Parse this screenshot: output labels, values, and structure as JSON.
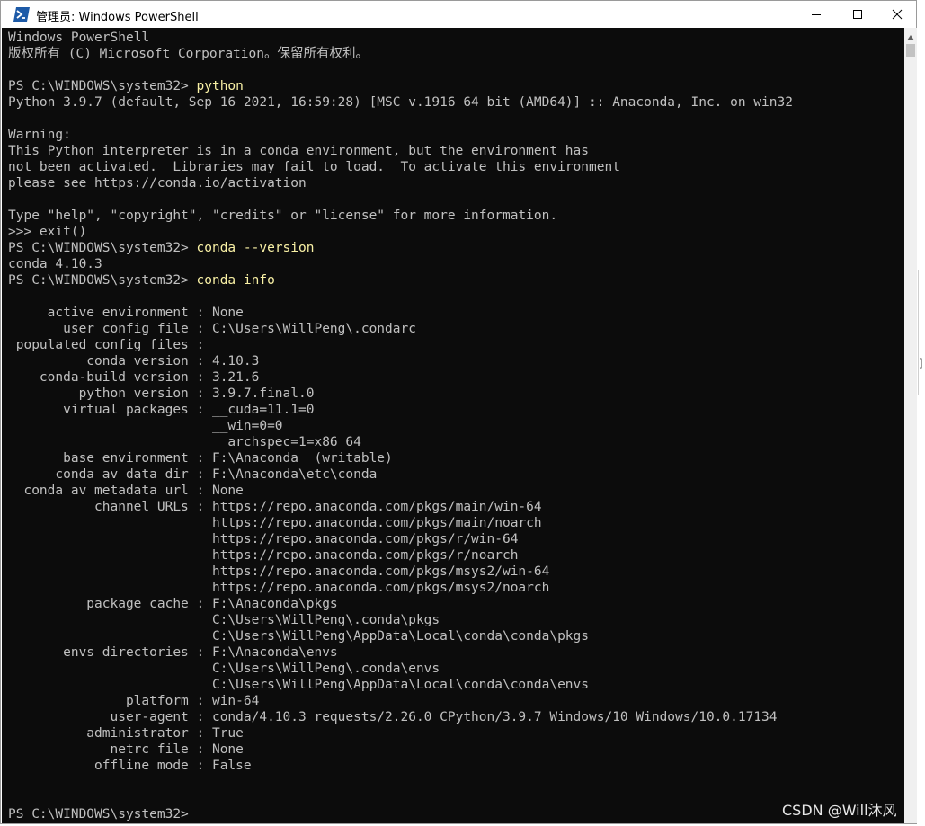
{
  "window": {
    "title": "管理员: Windows PowerShell",
    "icon": "powershell-icon",
    "controls": [
      "minimize-icon",
      "maximize-icon",
      "close-icon"
    ]
  },
  "colors": {
    "console_bg": "#0c0c0c",
    "console_text": "#c0c0c0",
    "command_text": "#f9f1a5",
    "powershell_blue": "#1d5aa7"
  },
  "console": {
    "lines": [
      {
        "text": "Windows PowerShell"
      },
      {
        "text": "版权所有 (C) Microsoft Corporation。保留所有权利。"
      },
      {
        "text": ""
      },
      {
        "prompt": "PS C:\\WINDOWS\\system32> ",
        "command": "python"
      },
      {
        "text": "Python 3.9.7 (default, Sep 16 2021, 16:59:28) [MSC v.1916 64 bit (AMD64)] :: Anaconda, Inc. on win32"
      },
      {
        "text": ""
      },
      {
        "text": "Warning:"
      },
      {
        "text": "This Python interpreter is in a conda environment, but the environment has"
      },
      {
        "text": "not been activated.  Libraries may fail to load.  To activate this environment"
      },
      {
        "text": "please see https://conda.io/activation"
      },
      {
        "text": ""
      },
      {
        "text": "Type \"help\", \"copyright\", \"credits\" or \"license\" for more information."
      },
      {
        "text": ">>> exit()"
      },
      {
        "prompt": "PS C:\\WINDOWS\\system32> ",
        "command": "conda --version"
      },
      {
        "text": "conda 4.10.3"
      },
      {
        "prompt": "PS C:\\WINDOWS\\system32> ",
        "command": "conda info"
      },
      {
        "text": ""
      },
      {
        "text": "     active environment : None"
      },
      {
        "text": "       user config file : C:\\Users\\WillPeng\\.condarc"
      },
      {
        "text": " populated config files : "
      },
      {
        "text": "          conda version : 4.10.3"
      },
      {
        "text": "    conda-build version : 3.21.6"
      },
      {
        "text": "         python version : 3.9.7.final.0"
      },
      {
        "text": "       virtual packages : __cuda=11.1=0"
      },
      {
        "text": "                          __win=0=0"
      },
      {
        "text": "                          __archspec=1=x86_64"
      },
      {
        "text": "       base environment : F:\\Anaconda  (writable)"
      },
      {
        "text": "      conda av data dir : F:\\Anaconda\\etc\\conda"
      },
      {
        "text": "  conda av metadata url : None"
      },
      {
        "text": "           channel URLs : https://repo.anaconda.com/pkgs/main/win-64"
      },
      {
        "text": "                          https://repo.anaconda.com/pkgs/main/noarch"
      },
      {
        "text": "                          https://repo.anaconda.com/pkgs/r/win-64"
      },
      {
        "text": "                          https://repo.anaconda.com/pkgs/r/noarch"
      },
      {
        "text": "                          https://repo.anaconda.com/pkgs/msys2/win-64"
      },
      {
        "text": "                          https://repo.anaconda.com/pkgs/msys2/noarch"
      },
      {
        "text": "          package cache : F:\\Anaconda\\pkgs"
      },
      {
        "text": "                          C:\\Users\\WillPeng\\.conda\\pkgs"
      },
      {
        "text": "                          C:\\Users\\WillPeng\\AppData\\Local\\conda\\conda\\pkgs"
      },
      {
        "text": "       envs directories : F:\\Anaconda\\envs"
      },
      {
        "text": "                          C:\\Users\\WillPeng\\.conda\\envs"
      },
      {
        "text": "                          C:\\Users\\WillPeng\\AppData\\Local\\conda\\conda\\envs"
      },
      {
        "text": "               platform : win-64"
      },
      {
        "text": "             user-agent : conda/4.10.3 requests/2.26.0 CPython/3.9.7 Windows/10 Windows/10.0.17134"
      },
      {
        "text": "          administrator : True"
      },
      {
        "text": "             netrc file : None"
      },
      {
        "text": "           offline mode : False"
      },
      {
        "text": ""
      },
      {
        "text": ""
      },
      {
        "prompt": "PS C:\\WINDOWS\\system32> ",
        "command": ""
      }
    ]
  },
  "side_fragment": "]",
  "watermark": "CSDN @Will沐风"
}
